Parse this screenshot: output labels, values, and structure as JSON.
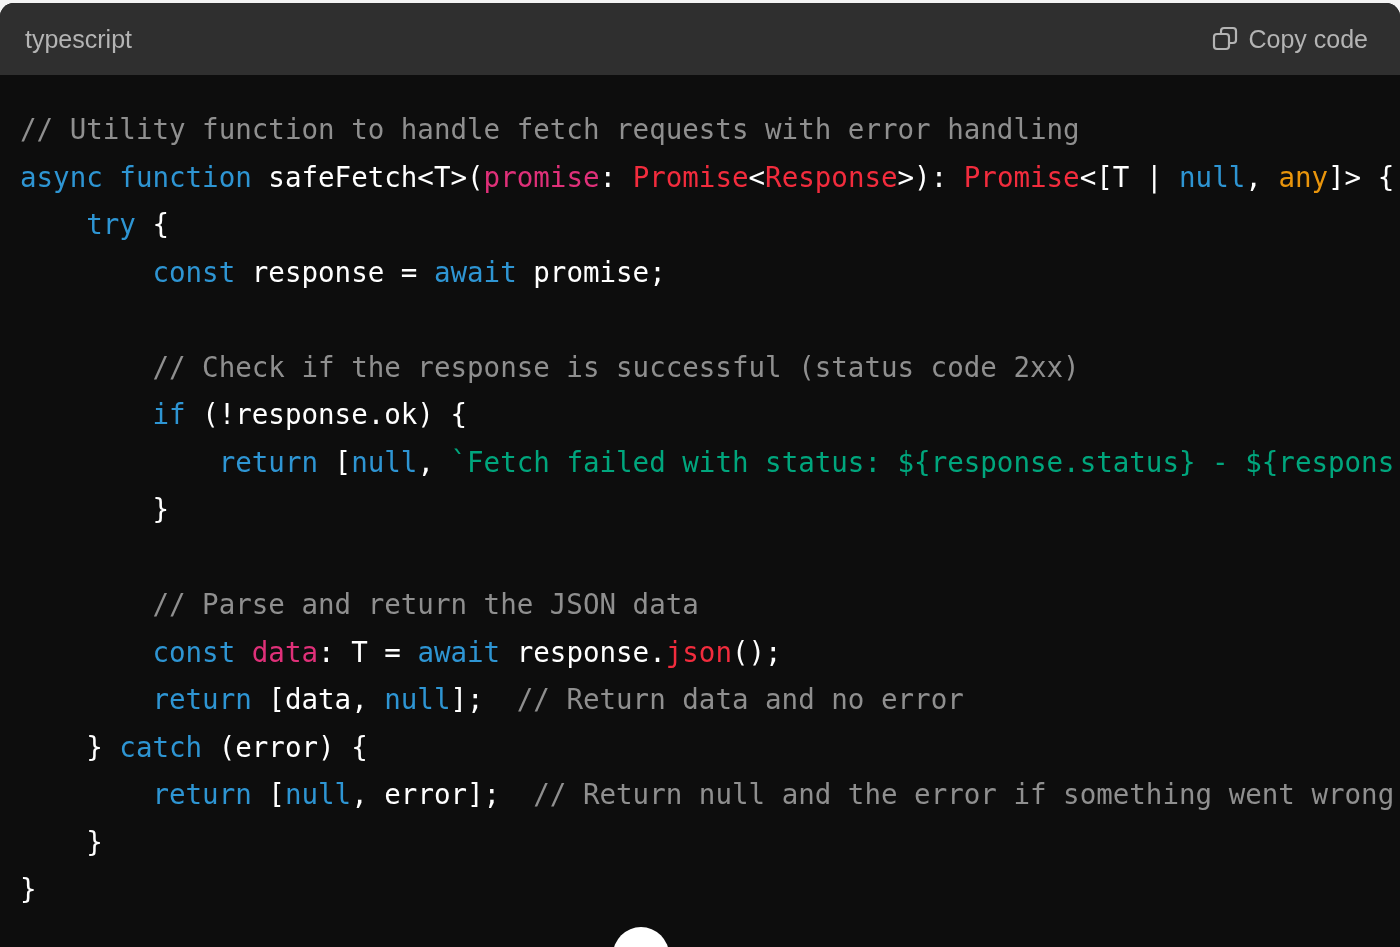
{
  "code_block": {
    "language": "typescript",
    "copy_button": "Copy code",
    "lines": [
      {
        "kind": "code",
        "tokens": [
          {
            "kind": "comment",
            "text": "// Utility function to handle fetch requests with error handling"
          }
        ]
      },
      {
        "kind": "code",
        "tokens": [
          {
            "kind": "keyword",
            "text": "async function"
          },
          {
            "kind": "plain",
            "text": " safeFetch<T>("
          },
          {
            "kind": "param",
            "text": "promise"
          },
          {
            "kind": "plain",
            "text": ": "
          },
          {
            "kind": "type",
            "text": "Promise"
          },
          {
            "kind": "plain",
            "text": "<"
          },
          {
            "kind": "type",
            "text": "Response"
          },
          {
            "kind": "plain",
            "text": ">): "
          },
          {
            "kind": "type",
            "text": "Promise"
          },
          {
            "kind": "plain",
            "text": "<[T | "
          },
          {
            "kind": "keyword",
            "text": "null"
          },
          {
            "kind": "plain",
            "text": ", "
          },
          {
            "kind": "builtin",
            "text": "any"
          },
          {
            "kind": "plain",
            "text": "]> {"
          }
        ]
      },
      {
        "kind": "code",
        "tokens": [
          {
            "kind": "keyword",
            "text": "    try"
          },
          {
            "kind": "plain",
            "text": " {"
          }
        ]
      },
      {
        "kind": "code",
        "tokens": [
          {
            "kind": "keyword",
            "text": "        const"
          },
          {
            "kind": "plain",
            "text": " response = "
          },
          {
            "kind": "keyword",
            "text": "await"
          },
          {
            "kind": "plain",
            "text": " promise;"
          }
        ]
      },
      {
        "kind": "blank"
      },
      {
        "kind": "code",
        "tokens": [
          {
            "kind": "comment",
            "text": "        // Check if the response is successful (status code 2xx)"
          }
        ]
      },
      {
        "kind": "code",
        "tokens": [
          {
            "kind": "keyword",
            "text": "        if"
          },
          {
            "kind": "plain",
            "text": " (!response.ok) {"
          }
        ]
      },
      {
        "kind": "code",
        "tokens": [
          {
            "kind": "keyword",
            "text": "            return"
          },
          {
            "kind": "plain",
            "text": " ["
          },
          {
            "kind": "keyword",
            "text": "null"
          },
          {
            "kind": "plain",
            "text": ", "
          },
          {
            "kind": "string",
            "text": "`Fetch failed with status: ${response.status} - ${respons"
          }
        ]
      },
      {
        "kind": "code",
        "tokens": [
          {
            "kind": "plain",
            "text": "        }"
          }
        ]
      },
      {
        "kind": "blank"
      },
      {
        "kind": "code",
        "tokens": [
          {
            "kind": "comment",
            "text": "        // Parse and return the JSON data"
          }
        ]
      },
      {
        "kind": "code",
        "tokens": [
          {
            "kind": "keyword",
            "text": "        const "
          },
          {
            "kind": "param",
            "text": "data"
          },
          {
            "kind": "plain",
            "text": ": T = "
          },
          {
            "kind": "keyword",
            "text": "await"
          },
          {
            "kind": "plain",
            "text": " response."
          },
          {
            "kind": "type",
            "text": "json"
          },
          {
            "kind": "plain",
            "text": "();"
          }
        ]
      },
      {
        "kind": "code",
        "tokens": [
          {
            "kind": "keyword",
            "text": "        return"
          },
          {
            "kind": "plain",
            "text": " [data, "
          },
          {
            "kind": "keyword",
            "text": "null"
          },
          {
            "kind": "plain",
            "text": "];  "
          },
          {
            "kind": "comment",
            "text": "// Return data and no error"
          }
        ]
      },
      {
        "kind": "code",
        "tokens": [
          {
            "kind": "plain",
            "text": "    } "
          },
          {
            "kind": "keyword",
            "text": "catch"
          },
          {
            "kind": "plain",
            "text": " (error) {"
          }
        ]
      },
      {
        "kind": "code",
        "tokens": [
          {
            "kind": "keyword",
            "text": "        return"
          },
          {
            "kind": "plain",
            "text": " ["
          },
          {
            "kind": "keyword",
            "text": "null"
          },
          {
            "kind": "plain",
            "text": ", error];  "
          },
          {
            "kind": "comment",
            "text": "// Return null and the error if something went wrong"
          }
        ]
      },
      {
        "kind": "code",
        "tokens": [
          {
            "kind": "plain",
            "text": "    }"
          }
        ]
      },
      {
        "kind": "code",
        "tokens": [
          {
            "kind": "plain",
            "text": "}"
          }
        ]
      }
    ]
  }
}
